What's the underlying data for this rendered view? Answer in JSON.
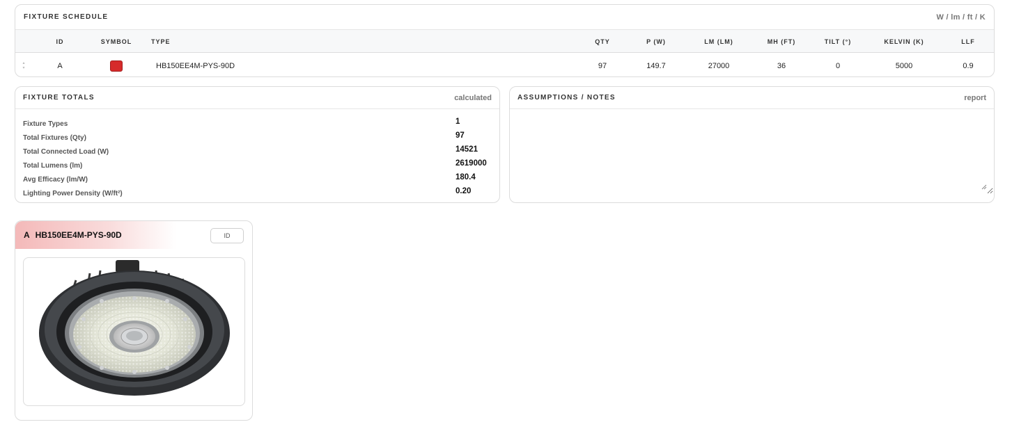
{
  "schedule": {
    "title": "FIXTURE SCHEDULE",
    "units": "W / lm / ft / K",
    "columns": {
      "id": "ID",
      "symbol": "SYMBOL",
      "type": "TYPE",
      "qty": "QTY",
      "p": "P (W)",
      "lm": "LM (LM)",
      "mh": "MH (FT)",
      "tilt": "TILT (°)",
      "kelvin": "KELVIN (K)",
      "llf": "LLF"
    },
    "rows": [
      {
        "id": "A",
        "symbol_color": "#d62b2b",
        "type": "HB150EE4M-PYS-90D",
        "qty": "97",
        "p": "149.7",
        "lm": "27000",
        "mh": "36",
        "tilt": "0",
        "kelvin": "5000",
        "llf": "0.9"
      }
    ]
  },
  "totals": {
    "title": "FIXTURE TOTALS",
    "aux": "calculated",
    "items": [
      {
        "label": "Fixture Types",
        "value": "1"
      },
      {
        "label": "Total Fixtures (Qty)",
        "value": "97"
      },
      {
        "label": "Total Connected Load (W)",
        "value": "14521"
      },
      {
        "label": "Total Lumens (lm)",
        "value": "2619000"
      },
      {
        "label": "Avg Efficacy (lm/W)",
        "value": "180.4"
      },
      {
        "label": "Lighting Power Density (W/ft²)",
        "value": "0.20"
      }
    ]
  },
  "notes": {
    "title": "ASSUMPTIONS / NOTES",
    "aux": "report",
    "value": ""
  },
  "card": {
    "id": "A",
    "type": "HB150EE4M-PYS-90D",
    "id_button": "ID",
    "image_icon": "highbay-fixture-image"
  }
}
